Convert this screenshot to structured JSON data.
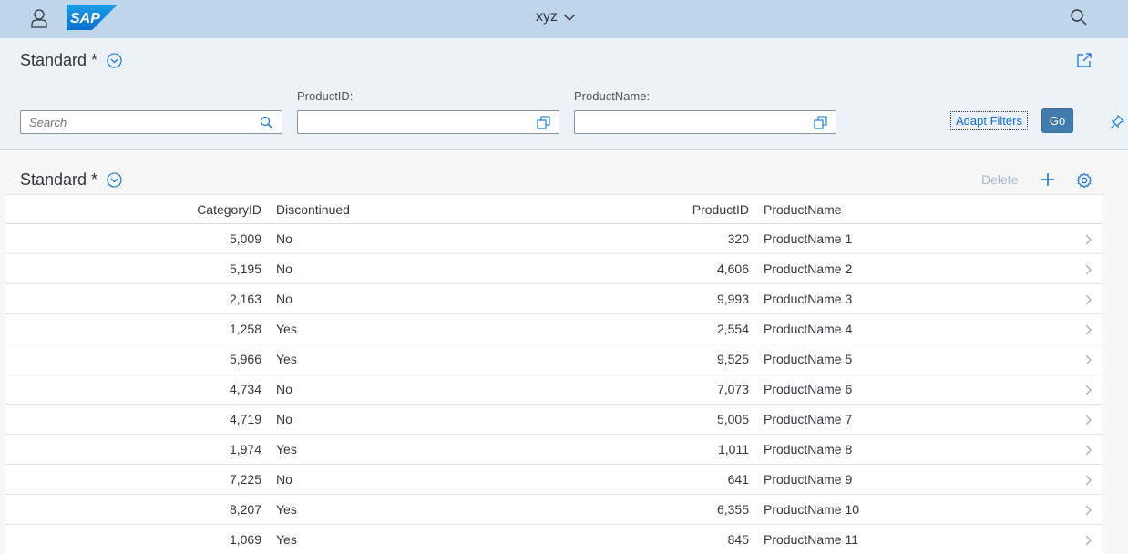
{
  "shell": {
    "title": "xyz",
    "logo_text": "SAP"
  },
  "filterbar": {
    "variant_label": "Standard *",
    "search_placeholder": "Search",
    "product_id_label": "ProductID:",
    "product_name_label": "ProductName:",
    "adapt_filters_label": "Adapt Filters",
    "go_label": "Go"
  },
  "table": {
    "variant_label": "Standard *",
    "delete_label": "Delete",
    "columns": [
      "CategoryID",
      "Discontinued",
      "ProductID",
      "ProductName"
    ],
    "rows": [
      [
        "5,009",
        "No",
        "320",
        "ProductName 1"
      ],
      [
        "5,195",
        "No",
        "4,606",
        "ProductName 2"
      ],
      [
        "2,163",
        "No",
        "9,993",
        "ProductName 3"
      ],
      [
        "1,258",
        "Yes",
        "2,554",
        "ProductName 4"
      ],
      [
        "5,966",
        "Yes",
        "9,525",
        "ProductName 5"
      ],
      [
        "4,734",
        "No",
        "7,073",
        "ProductName 6"
      ],
      [
        "4,719",
        "No",
        "5,005",
        "ProductName 7"
      ],
      [
        "1,974",
        "Yes",
        "1,011",
        "ProductName 8"
      ],
      [
        "7,225",
        "No",
        "641",
        "ProductName 9"
      ],
      [
        "8,207",
        "Yes",
        "6,355",
        "ProductName 10"
      ],
      [
        "1,069",
        "Yes",
        "845",
        "ProductName 11"
      ]
    ]
  },
  "colors": {
    "shell_bg": "#bfd6ea",
    "filter_bg": "#edf2f8",
    "accent": "#0a6ed1",
    "go_button": "#427cac"
  }
}
